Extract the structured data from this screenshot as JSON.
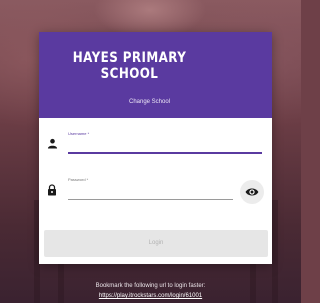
{
  "header": {
    "school_name": "HAYES PRIMARY SCHOOL",
    "change_school_label": "Change School"
  },
  "login_form": {
    "username": {
      "label": "Username *",
      "value": "",
      "icon": "person-icon"
    },
    "password": {
      "label": "Password *",
      "value": "",
      "icon": "lock-icon",
      "toggle_icon": "eye-icon"
    },
    "login_button_label": "Login"
  },
  "footer": {
    "bookmark_text": "Bookmark the following url to login faster:",
    "bookmark_url": "https://play.itrockstars.com/login/61001"
  },
  "colors": {
    "accent": "#5a3aa0",
    "disabled_button": "#e6e6e6"
  }
}
